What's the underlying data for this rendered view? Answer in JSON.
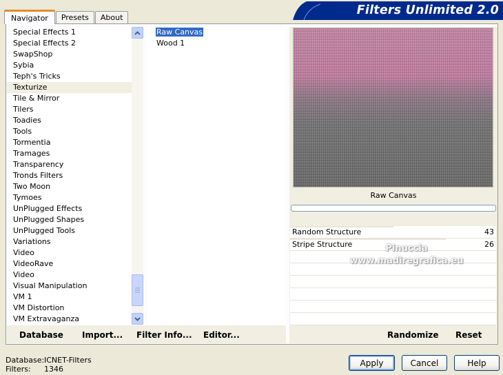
{
  "tabs": [
    "Navigator",
    "Presets",
    "About"
  ],
  "banner": {
    "title": "Filters Unlimited 2.0",
    "color": "#002a8c"
  },
  "categories": {
    "items": [
      "Special Effects 1",
      "Special Effects 2",
      "SwapShop",
      "Sybia",
      "Teph's Tricks",
      "Texturize",
      "Tile & Mirror",
      "Tilers",
      "Toadies",
      "Tools",
      "Tormentia",
      "Tramages",
      "Transparency",
      "Tronds Filters",
      "Two Moon",
      "Tymoes",
      "UnPlugged Effects",
      "UnPlugged Shapes",
      "UnPlugged Tools",
      "Variations",
      "Video",
      "VideoRave",
      "Video",
      "Visual Manipulation",
      "VM 1",
      "VM Distortion",
      "VM Extravaganza"
    ],
    "selected_index": 5
  },
  "filters": {
    "items": [
      "Raw Canvas",
      "Wood 1"
    ],
    "selected_index": 0
  },
  "preview": {
    "filter_name": "Raw Canvas"
  },
  "params": [
    {
      "label": "Random Structure",
      "value": 43
    },
    {
      "label": "Stripe Structure",
      "value": 26
    }
  ],
  "watermark": {
    "line1": "Pinuccia",
    "line2": "www.madiregrafica.eu"
  },
  "toolbar": {
    "database": "Database",
    "import": "Import...",
    "filter_info": "Filter Info...",
    "editor": "Editor...",
    "randomize": "Randomize",
    "reset": "Reset"
  },
  "status": {
    "database_label": "Database:",
    "database_value": "ICNET-Filters",
    "filters_label": "Filters:",
    "filters_value": "1346"
  },
  "buttons": {
    "apply": "Apply",
    "cancel": "Cancel",
    "help": "Help"
  }
}
